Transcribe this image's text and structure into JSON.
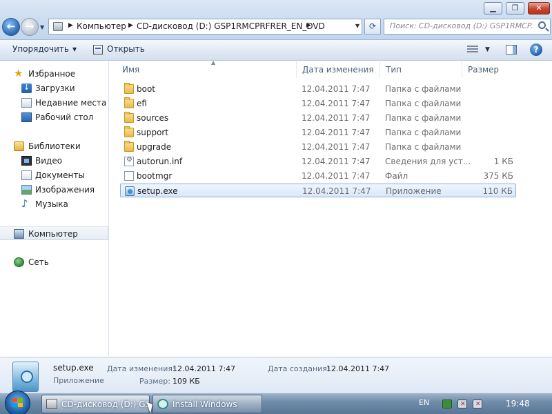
{
  "window": {
    "controls": {
      "minimize": "▁",
      "maximize": "❐",
      "close": "✕"
    }
  },
  "address_bar": {
    "crumbs": [
      "Компьютер",
      "CD-дисковод (D:) GSP1RMCPRFRER_EN_DVD"
    ],
    "search_placeholder": "Поиск: CD-дисковод (D:) GSP1RMCP..."
  },
  "toolbar": {
    "organize_label": "Упорядочить",
    "open_label": "Открыть"
  },
  "sidebar": {
    "favorites": {
      "label": "Избранное",
      "items": [
        "Загрузки",
        "Недавние места",
        "Рабочий стол"
      ]
    },
    "libraries": {
      "label": "Библиотеки",
      "items": [
        "Видео",
        "Документы",
        "Изображения",
        "Музыка"
      ]
    },
    "computer_label": "Компьютер",
    "network_label": "Сеть"
  },
  "file_list": {
    "columns": [
      "Имя",
      "Дата изменения",
      "Тип",
      "Размер"
    ],
    "rows": [
      {
        "name": "boot",
        "date": "12.04.2011 7:47",
        "type": "Папка с файлами",
        "size": "",
        "icon": "folder-icon"
      },
      {
        "name": "efi",
        "date": "12.04.2011 7:47",
        "type": "Папка с файлами",
        "size": "",
        "icon": "folder-icon"
      },
      {
        "name": "sources",
        "date": "12.04.2011 7:47",
        "type": "Папка с файлами",
        "size": "",
        "icon": "folder-icon"
      },
      {
        "name": "support",
        "date": "12.04.2011 7:47",
        "type": "Папка с файлами",
        "size": "",
        "icon": "folder-icon"
      },
      {
        "name": "upgrade",
        "date": "12.04.2011 7:47",
        "type": "Папка с файлами",
        "size": "",
        "icon": "folder-icon"
      },
      {
        "name": "autorun.inf",
        "date": "12.04.2011 7:47",
        "type": "Сведения для уст...",
        "size": "1 КБ",
        "icon": "settings-file-icon"
      },
      {
        "name": "bootmgr",
        "date": "12.04.2011 7:47",
        "type": "Файл",
        "size": "375 КБ",
        "icon": "file-icon"
      },
      {
        "name": "setup.exe",
        "date": "12.04.2011 7:47",
        "type": "Приложение",
        "size": "110 КБ",
        "icon": "setup-exe-icon",
        "selected": true
      }
    ]
  },
  "details": {
    "name": "setup.exe",
    "type": "Приложение",
    "modified_label": "Дата изменения:",
    "modified_value": "12.04.2011 7:47",
    "created_label": "Дата создания:",
    "created_value": "12.04.2011 7:47",
    "size_label": "Размер:",
    "size_value": "109 КБ"
  },
  "taskbar": {
    "tasks": [
      "CD-дисковод (D:) GS...",
      "Install Windows"
    ],
    "language": "EN",
    "time": "19:48"
  },
  "colors": {
    "selection_border": "#84acdd",
    "selection_fill": "#d9e8fa",
    "taskbar": "#6d8aa7",
    "close_button": "#c5462c"
  }
}
